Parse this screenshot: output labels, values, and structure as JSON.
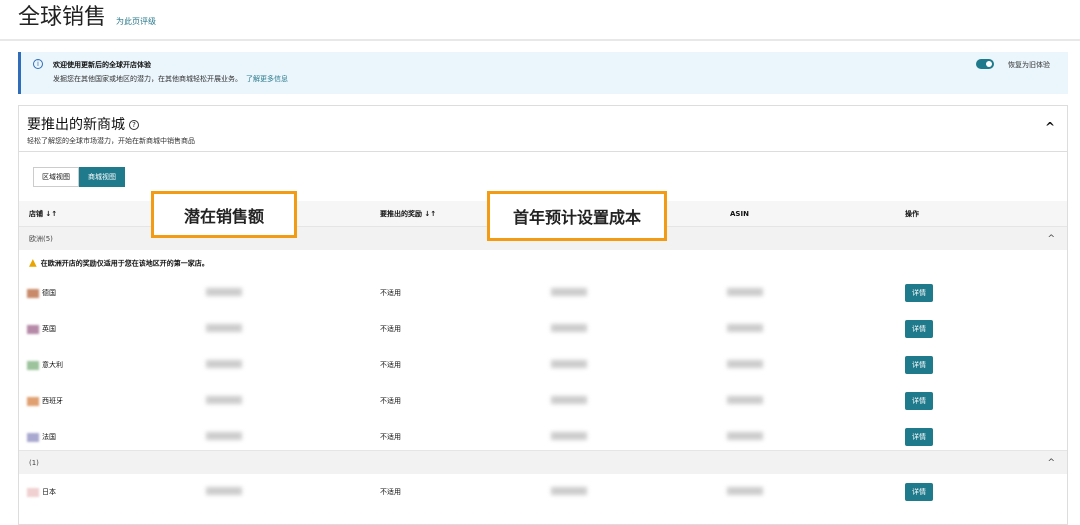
{
  "header": {
    "title": "全球销售",
    "rate_link": "为此页评级"
  },
  "banner": {
    "title": "欢迎使用更新后的全球开店体验",
    "text": "发掘您在其他国家或地区的潜力，在其他商城轻松开展业务。",
    "link": "了解更多信息",
    "toggle_label": "恢复为旧体验",
    "toggle_on": true
  },
  "card": {
    "title": "要推出的新商城",
    "subtitle": "轻松了解您的全球市场潜力，开始在新商城中销售商品",
    "views": [
      "区域视图",
      "商城视图"
    ],
    "active_view": "商城视图",
    "columns": {
      "store": "店铺 ↓↑",
      "incentive": "要推出的奖励 ↓↑",
      "asin": "ASIN",
      "action": "操作"
    },
    "groups": [
      {
        "label": "欧洲(5)",
        "warning": "在欧洲开店的奖励仅适用于您在该地区开的第一家店。",
        "rows": [
          {
            "store": "德国",
            "incentive": "不适用",
            "action": "详情"
          },
          {
            "store": "英国",
            "incentive": "不适用",
            "action": "详情"
          },
          {
            "store": "意大利",
            "incentive": "不适用",
            "action": "详情"
          },
          {
            "store": "西班牙",
            "incentive": "不适用",
            "action": "详情"
          },
          {
            "store": "法国",
            "incentive": "不适用",
            "action": "详情"
          }
        ]
      },
      {
        "label": "(1)",
        "rows": [
          {
            "store": "日本",
            "incentive": "不适用",
            "action": "详情"
          }
        ]
      }
    ]
  },
  "annotations": [
    "潜在销售额",
    "首年预计设置成本"
  ],
  "colors": {
    "accent": "#1f7a8c",
    "annotation": "#f29b13",
    "info": "#2f6dbb"
  }
}
